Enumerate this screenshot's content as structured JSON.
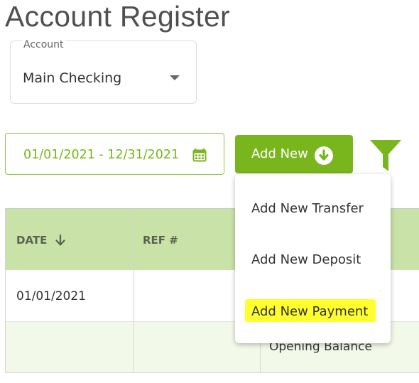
{
  "page": {
    "title": "Account Register"
  },
  "account": {
    "label": "Account",
    "value": "Main Checking"
  },
  "date_range": {
    "value": "01/01/2021 - 12/31/2021"
  },
  "toolbar": {
    "add_new_label": "Add New"
  },
  "dropdown": {
    "items": [
      {
        "label": "Add New Transfer"
      },
      {
        "label": "Add New Deposit"
      },
      {
        "label": "Add New Payment",
        "highlighted": true
      }
    ]
  },
  "table": {
    "columns": [
      "DATE",
      "REF #"
    ],
    "rows": [
      {
        "date": "01/01/2021",
        "ref": "",
        "description": ""
      },
      {
        "date": "",
        "ref": "",
        "description": "Opening Balance"
      }
    ]
  },
  "colors": {
    "accent": "#79b51c",
    "header_bg": "#c8e2a8",
    "alt_row_bg": "#f3f9e9",
    "highlight": "#ffff2e"
  },
  "icons": {
    "calendar": "calendar-icon",
    "add_new": "arrow-down-circle-icon",
    "filter": "filter-icon",
    "sort": "arrow-down-icon",
    "dropdown": "caret-down-icon"
  }
}
